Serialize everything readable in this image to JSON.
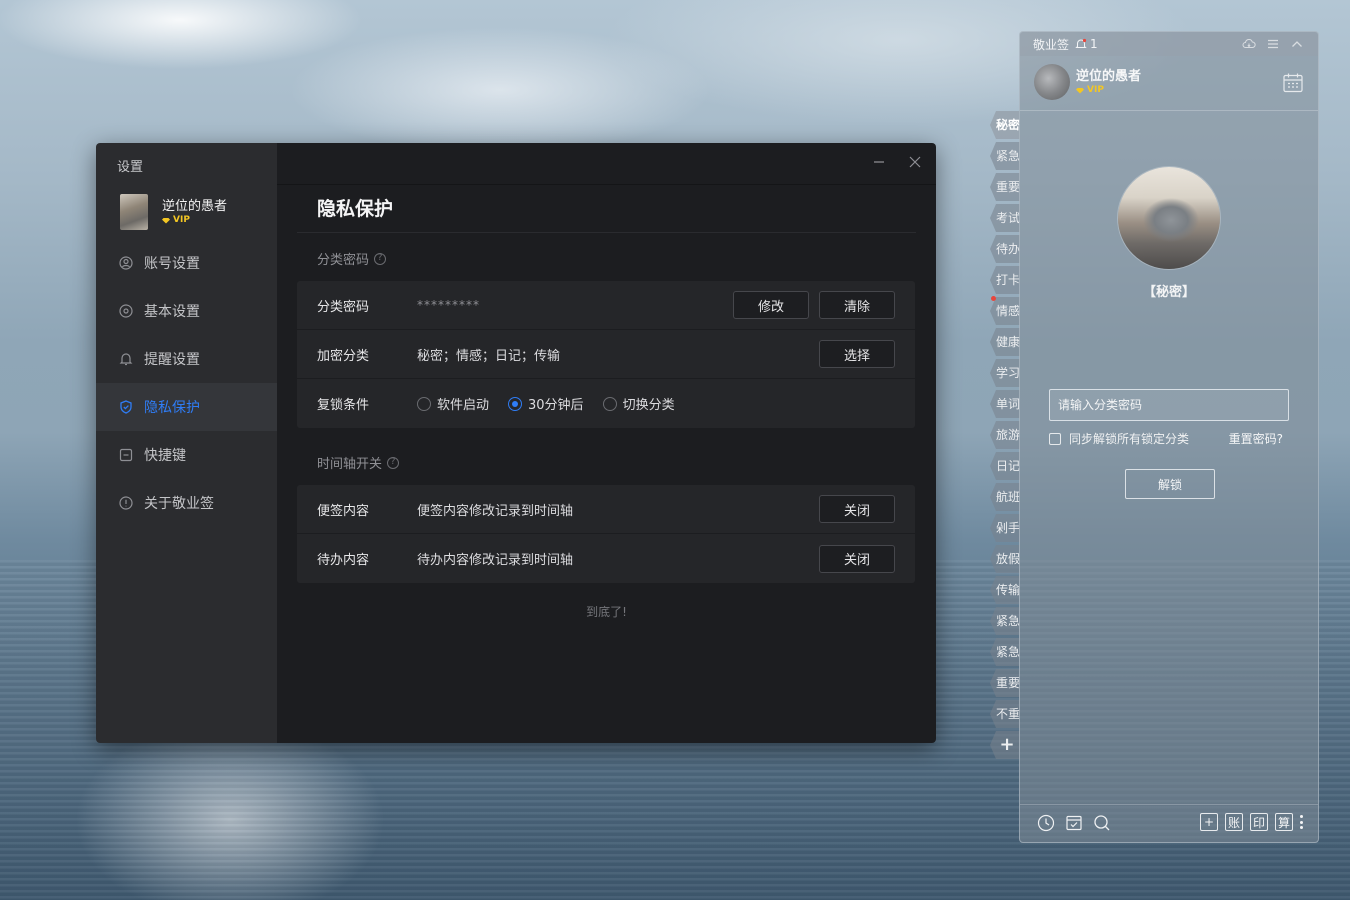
{
  "settings": {
    "window_title": "设置",
    "user": {
      "name": "逆位的愚者",
      "badge": "VIP"
    },
    "nav": [
      {
        "label": "账号设置",
        "icon": "account-icon"
      },
      {
        "label": "基本设置",
        "icon": "gear-icon"
      },
      {
        "label": "提醒设置",
        "icon": "bell-icon"
      },
      {
        "label": "隐私保护",
        "icon": "shield-icon",
        "active": true
      },
      {
        "label": "快捷键",
        "icon": "keyboard-icon"
      },
      {
        "label": "关于敬业签",
        "icon": "info-icon"
      }
    ],
    "page_title": "隐私保护",
    "category_password": {
      "section_label": "分类密码",
      "password_row": {
        "label": "分类密码",
        "value": "*********",
        "edit_button": "修改",
        "clear_button": "清除"
      },
      "encrypted_row": {
        "label": "加密分类",
        "value": "秘密；情感；日记；传输",
        "select_button": "选择"
      },
      "relock_row": {
        "label": "复锁条件",
        "options": [
          "软件启动",
          "30分钟后",
          "切换分类"
        ],
        "selected": "30分钟后"
      }
    },
    "timeline": {
      "section_label": "时间轴开关",
      "rows": [
        {
          "label": "便签内容",
          "description": "便签内容修改记录到时间轴",
          "button": "关闭"
        },
        {
          "label": "待办内容",
          "description": "待办内容修改记录到时间轴",
          "button": "关闭"
        }
      ]
    },
    "end_text": "到底了!"
  },
  "note": {
    "app_name": "敬业签",
    "notification_count": "1",
    "user": {
      "name": "逆位的愚者",
      "badge": "VIP"
    },
    "locked_category": "【秘密】",
    "password_placeholder": "请输入分类密码",
    "sync_unlock_label": "同步解锁所有锁定分类",
    "reset_link": "重置密码?",
    "unlock_button": "解锁",
    "footer_left_icons": [
      "clock-icon",
      "todo-icon",
      "search-icon"
    ],
    "footer_buttons": [
      "+",
      "账",
      "印",
      "算"
    ]
  },
  "tabs": [
    "秘密",
    "紧急",
    "重要",
    "考试",
    "待办",
    "打卡",
    "情感",
    "健康",
    "学习",
    "单词",
    "旅游",
    "日记",
    "航班",
    "剁手",
    "放假",
    "传输",
    "紧急",
    "紧急",
    "重要",
    "不重"
  ],
  "active_tab": "秘密",
  "add_tab_label": "+",
  "colors": {
    "accent": "#2f7df6",
    "vip": "#f3c623",
    "settings_bg": "#1c1d20",
    "sidebar_bg": "#2b2c2f",
    "notification_dot": "#e8463c"
  }
}
